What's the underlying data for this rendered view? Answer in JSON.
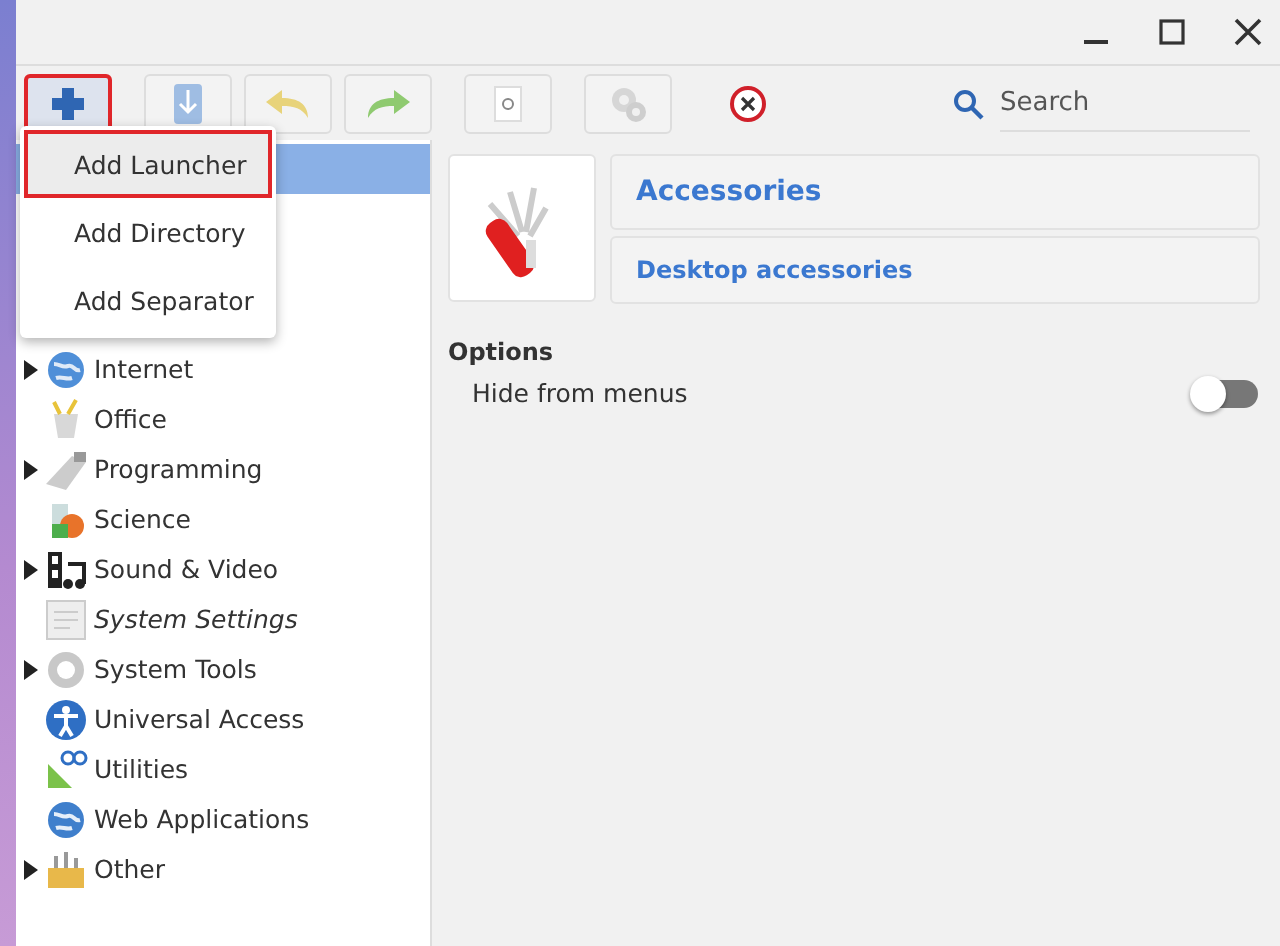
{
  "window_controls": [
    {
      "kind": "minimize"
    },
    {
      "kind": "maximize"
    },
    {
      "kind": "close"
    }
  ],
  "toolbar": {
    "buttons": [
      {
        "kind": "add",
        "highlighted": true,
        "disabled": false
      },
      {
        "kind": "save",
        "highlighted": false,
        "disabled": false
      },
      {
        "kind": "undo",
        "highlighted": false,
        "disabled": false
      },
      {
        "kind": "redo",
        "highlighted": false,
        "disabled": false
      },
      {
        "kind": "revert",
        "highlighted": false,
        "disabled": false
      },
      {
        "kind": "execute",
        "highlighted": false,
        "disabled": true
      },
      {
        "kind": "delete",
        "highlighted": false,
        "disabled": false
      }
    ],
    "search": {
      "placeholder": "Search"
    }
  },
  "menu": {
    "items": [
      {
        "label": "Add Launcher",
        "selected": true
      },
      {
        "label": "Add Directory",
        "selected": false
      },
      {
        "label": "Add Separator",
        "selected": false
      }
    ]
  },
  "tree": {
    "covered_rows": [
      {
        "selected": true
      }
    ],
    "items": [
      {
        "label": "Internet",
        "expandable": true,
        "hidden": false
      },
      {
        "label": "Office",
        "expandable": false,
        "hidden": false
      },
      {
        "label": "Programming",
        "expandable": true,
        "hidden": false
      },
      {
        "label": "Science",
        "expandable": false,
        "hidden": false
      },
      {
        "label": "Sound & Video",
        "expandable": true,
        "hidden": false
      },
      {
        "label": "System Settings",
        "expandable": false,
        "hidden": true
      },
      {
        "label": "System Tools",
        "expandable": true,
        "hidden": false
      },
      {
        "label": "Universal Access",
        "expandable": false,
        "hidden": false
      },
      {
        "label": "Utilities",
        "expandable": false,
        "hidden": false
      },
      {
        "label": "Web Applications",
        "expandable": false,
        "hidden": false
      },
      {
        "label": "Other",
        "expandable": true,
        "hidden": false
      }
    ]
  },
  "details": {
    "name": "Accessories",
    "comment": "Desktop accessories",
    "options_heading": "Options",
    "options": [
      {
        "label": "Hide from menus",
        "on": false
      }
    ]
  }
}
